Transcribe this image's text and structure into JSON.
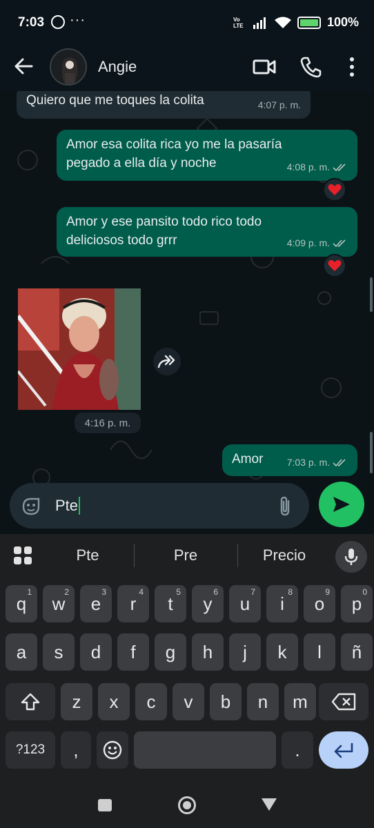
{
  "status_bar": {
    "time": "7:03",
    "dots": "···",
    "network": "Vo LTE",
    "battery": "100%"
  },
  "header": {
    "contact_name": "Angie"
  },
  "messages": [
    {
      "direction": "in",
      "text": "Quiero que me toques la colita",
      "time": "4:07 p. m."
    },
    {
      "direction": "out",
      "text_lines": [
        "Amor esa colita rica yo me la pasaría",
        "pegado a ella día y noche"
      ],
      "time": "4:08 p. m.",
      "reaction": "heart"
    },
    {
      "direction": "out",
      "text_lines": [
        "Amor y ese pansito todo rico todo",
        "deliciosos todo grrr"
      ],
      "time": "4:09 p. m.",
      "reaction": "heart"
    },
    {
      "direction": "in",
      "type": "image",
      "time": "4:16 p. m."
    },
    {
      "direction": "out",
      "text": "Amor",
      "time": "7:03 p. m."
    }
  ],
  "composer": {
    "input_value": "Pte"
  },
  "keyboard": {
    "suggestions": [
      "Pte",
      "Pre",
      "Precio"
    ],
    "row1": [
      {
        "k": "q",
        "h": "1"
      },
      {
        "k": "w",
        "h": "2"
      },
      {
        "k": "e",
        "h": "3"
      },
      {
        "k": "r",
        "h": "4"
      },
      {
        "k": "t",
        "h": "5"
      },
      {
        "k": "y",
        "h": "6"
      },
      {
        "k": "u",
        "h": "7"
      },
      {
        "k": "i",
        "h": "8"
      },
      {
        "k": "o",
        "h": "9"
      },
      {
        "k": "p",
        "h": "0"
      }
    ],
    "row2": [
      "a",
      "s",
      "d",
      "f",
      "g",
      "h",
      "j",
      "k",
      "l",
      "ñ"
    ],
    "row3": [
      "z",
      "x",
      "c",
      "v",
      "b",
      "n",
      "m"
    ],
    "symbols_key": "?123",
    "comma_key": ",",
    "period_key": "."
  },
  "colors": {
    "outgoing_bubble": "#005c4b",
    "incoming_bubble": "#202c33",
    "accent_green": "#21c063",
    "enter_key": "#b7d1f8"
  }
}
